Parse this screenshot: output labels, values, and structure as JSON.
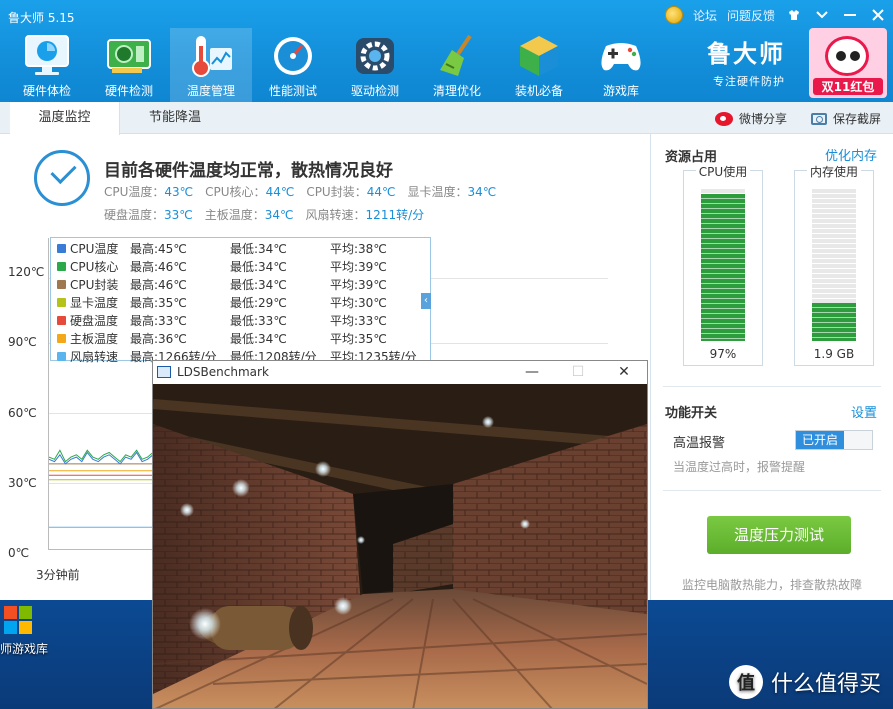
{
  "app": {
    "title": "鲁大师 5.15",
    "actions": {
      "forum": "论坛",
      "feedback": "问题反馈"
    }
  },
  "nav": [
    {
      "label": "硬件体检",
      "icon": "monitor-icon"
    },
    {
      "label": "硬件检测",
      "icon": "graphics-card-icon"
    },
    {
      "label": "温度管理",
      "icon": "thermometer-icon"
    },
    {
      "label": "性能测试",
      "icon": "speedometer-icon"
    },
    {
      "label": "驱动检测",
      "icon": "gear-icon"
    },
    {
      "label": "清理优化",
      "icon": "broom-icon"
    },
    {
      "label": "装机必备",
      "icon": "cube-icon"
    },
    {
      "label": "游戏库",
      "icon": "gamepad-icon"
    }
  ],
  "brand": {
    "name": "鲁大师",
    "slogan": "专注硬件防护"
  },
  "promo": {
    "text": "双11红包"
  },
  "subtabs": {
    "monitor": "温度监控",
    "cooling": "节能降温"
  },
  "tools": {
    "share": "微博分享",
    "screenshot": "保存截屏"
  },
  "status": {
    "title": "目前各硬件温度均正常，散热情况良好",
    "cpu_temp_label": "CPU温度：",
    "cpu_temp": "43℃",
    "cpu_core_label": "CPU核心：",
    "cpu_core": "44℃",
    "cpu_pkg_label": "CPU封装：",
    "cpu_pkg": "44℃",
    "gpu_label": "显卡温度：",
    "gpu": "34℃",
    "disk_label": "硬盘温度：",
    "disk": "33℃",
    "board_label": "主板温度：",
    "board": "34℃",
    "fan_label": "风扇转速：",
    "fan": "1211转/分"
  },
  "chart_data": {
    "type": "line",
    "yticks": [
      "120℃",
      "90℃",
      "60℃",
      "30℃",
      "0℃"
    ],
    "ylim": [
      0,
      120
    ],
    "xlabel": "3分钟前",
    "series": [
      {
        "name": "CPU温度",
        "color": "#3a7bd5",
        "max": "最高:45℃",
        "min": "最低:34℃",
        "avg": "平均:38℃",
        "values": [
          40,
          39,
          42,
          38,
          40,
          41,
          39,
          43,
          40,
          39,
          41,
          42,
          40,
          38,
          41,
          40,
          43,
          39,
          40,
          42
        ]
      },
      {
        "name": "CPU核心",
        "color": "#2aa84a",
        "max": "最高:46℃",
        "min": "最低:34℃",
        "avg": "平均:39℃",
        "values": [
          41,
          40,
          44,
          39,
          41,
          42,
          40,
          44,
          41,
          40,
          42,
          43,
          41,
          39,
          42,
          41,
          44,
          40,
          41,
          43
        ]
      },
      {
        "name": "CPU封装",
        "color": "#a07850",
        "max": "最高:46℃",
        "min": "最低:34℃",
        "avg": "平均:39℃",
        "values": [
          38,
          38,
          38,
          38,
          38,
          38,
          38,
          38,
          38,
          38,
          38,
          38,
          38,
          38,
          38,
          38,
          38,
          38,
          38,
          38
        ]
      },
      {
        "name": "显卡温度",
        "color": "#b5c21b",
        "max": "最高:35℃",
        "min": "最低:29℃",
        "avg": "平均:30℃",
        "values": [
          31,
          31,
          31,
          31,
          31,
          31,
          31,
          31,
          31,
          31,
          31,
          31,
          31,
          31,
          31,
          31,
          31,
          31,
          31,
          31
        ]
      },
      {
        "name": "硬盘温度",
        "color": "#e64a3b",
        "max": "最高:33℃",
        "min": "最低:33℃",
        "avg": "平均:33℃",
        "values": [
          33,
          33,
          33,
          33,
          33,
          33,
          33,
          33,
          33,
          33,
          33,
          33,
          33,
          33,
          33,
          33,
          33,
          33,
          33,
          33
        ]
      },
      {
        "name": "主板温度",
        "color": "#f2a818",
        "max": "最高:36℃",
        "min": "最低:34℃",
        "avg": "平均:35℃",
        "values": [
          35,
          35,
          35,
          35,
          35,
          35,
          35,
          35,
          35,
          35,
          35,
          35,
          35,
          35,
          35,
          35,
          35,
          35,
          35,
          35
        ]
      },
      {
        "name": "风扇转速",
        "color": "#5ab4ee",
        "max": "最高:1266转/分",
        "min": "最低:1208转/分",
        "avg": "平均:1235转/分",
        "values": [
          10,
          10,
          10,
          10,
          10,
          10,
          10,
          10,
          10,
          10,
          10,
          10,
          10,
          10,
          10,
          10,
          10,
          10,
          10,
          10
        ]
      }
    ]
  },
  "resources": {
    "title": "资源占用",
    "optimize": "优化内存",
    "cpu": {
      "label": "CPU使用",
      "value": "97%",
      "fraction": 0.97
    },
    "memory": {
      "label": "内存使用",
      "value": "1.9 GB",
      "fraction": 0.25
    }
  },
  "features": {
    "title": "功能开关",
    "settings": "设置",
    "alarm_label": "高温报警",
    "alarm_state": "已开启",
    "alarm_desc": "当温度过高时，报警提醒"
  },
  "stress": {
    "button": "温度压力测试",
    "desc": "监控电脑散热能力，排查散热故障"
  },
  "benchmark": {
    "title": "LDSBenchmark",
    "minimize": "—",
    "maximize": "☐",
    "close": "✕"
  },
  "desktop": {
    "icon_label": "师游戏库",
    "watermark": "什么值得买",
    "watermark_logo": "值"
  }
}
